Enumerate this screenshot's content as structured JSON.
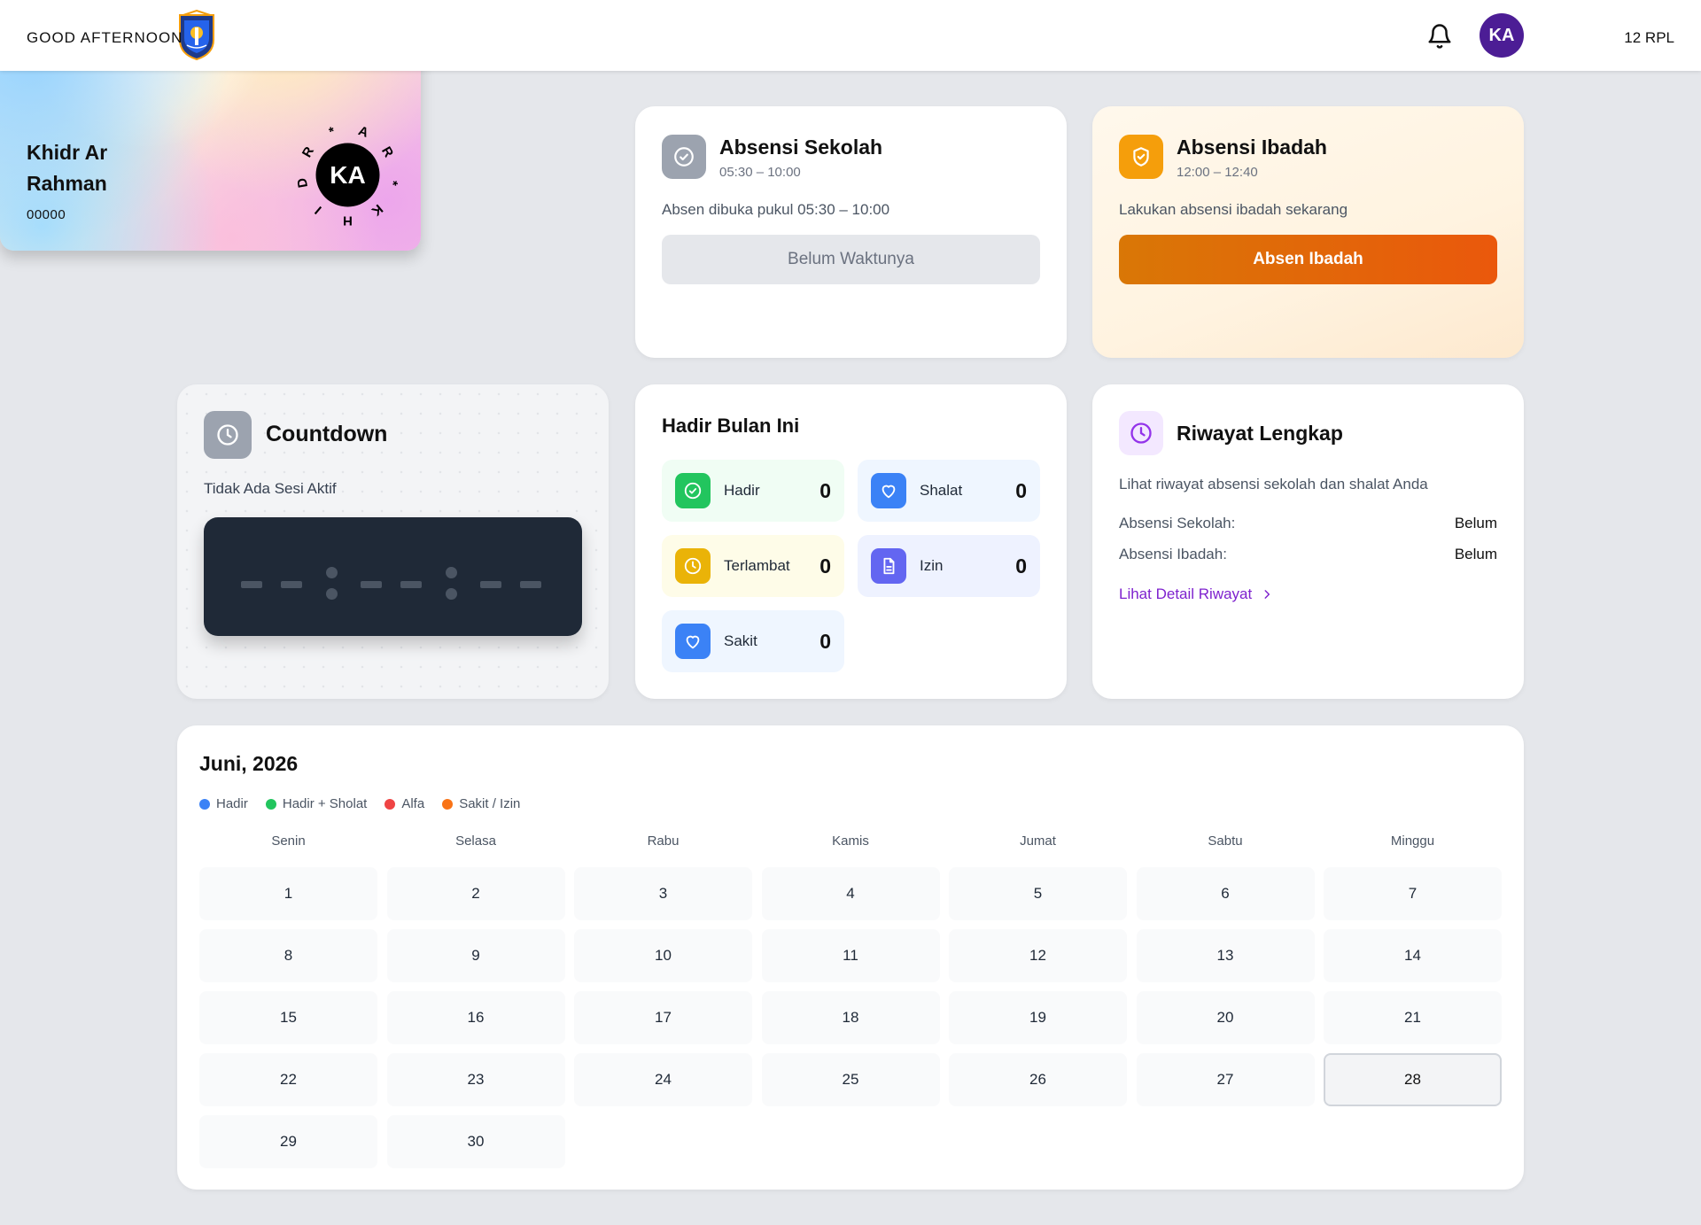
{
  "header": {
    "avatar_initials": "KA"
  },
  "profile": {
    "greeting": "GOOD AFTERNOON",
    "class": "12 RPL",
    "name": "Khidr Ar Rahman",
    "nis": "00000",
    "seal_initials": "KA",
    "seal_ring_text": "ARKHIDR"
  },
  "absensi_sekolah": {
    "title": "Absensi Sekolah",
    "time": "05:30 – 10:00",
    "description": "Absen dibuka pukul 05:30 – 10:00",
    "button": "Belum Waktunya"
  },
  "absensi_ibadah": {
    "title": "Absensi Ibadah",
    "time": "12:00 – 12:40",
    "description": "Lakukan absensi ibadah sekarang",
    "button": "Absen Ibadah"
  },
  "countdown": {
    "title": "Countdown",
    "status": "Tidak Ada Sesi Aktif"
  },
  "hadir_bulan_ini": {
    "title": "Hadir Bulan Ini",
    "stats": [
      {
        "label": "Hadir",
        "value": "0"
      },
      {
        "label": "Shalat",
        "value": "0"
      },
      {
        "label": "Terlambat",
        "value": "0"
      },
      {
        "label": "Izin",
        "value": "0"
      },
      {
        "label": "Sakit",
        "value": "0"
      }
    ]
  },
  "riwayat": {
    "title": "Riwayat Lengkap",
    "description": "Lihat riwayat absensi sekolah dan shalat Anda",
    "rows": [
      {
        "label": "Absensi Sekolah:",
        "value": "Belum"
      },
      {
        "label": "Absensi Ibadah:",
        "value": "Belum"
      }
    ],
    "link": "Lihat Detail Riwayat"
  },
  "calendar": {
    "title": "Juni, 2026",
    "legend": [
      {
        "label": "Hadir",
        "color": "#3b82f6"
      },
      {
        "label": "Hadir + Sholat",
        "color": "#22c55e"
      },
      {
        "label": "Alfa",
        "color": "#ef4444"
      },
      {
        "label": "Sakit / Izin",
        "color": "#f97316"
      }
    ],
    "weekdays": [
      "Senin",
      "Selasa",
      "Rabu",
      "Kamis",
      "Jumat",
      "Sabtu",
      "Minggu"
    ],
    "days": [
      "1",
      "2",
      "3",
      "4",
      "5",
      "6",
      "7",
      "8",
      "9",
      "10",
      "11",
      "12",
      "13",
      "14",
      "15",
      "16",
      "17",
      "18",
      "19",
      "20",
      "21",
      "22",
      "23",
      "24",
      "25",
      "26",
      "27",
      "28",
      "29",
      "30"
    ],
    "today": "28"
  },
  "colors": {
    "accent_purple": "#4c1d95",
    "ibadah_orange": "#ea580c",
    "link_purple": "#7e22ce"
  }
}
